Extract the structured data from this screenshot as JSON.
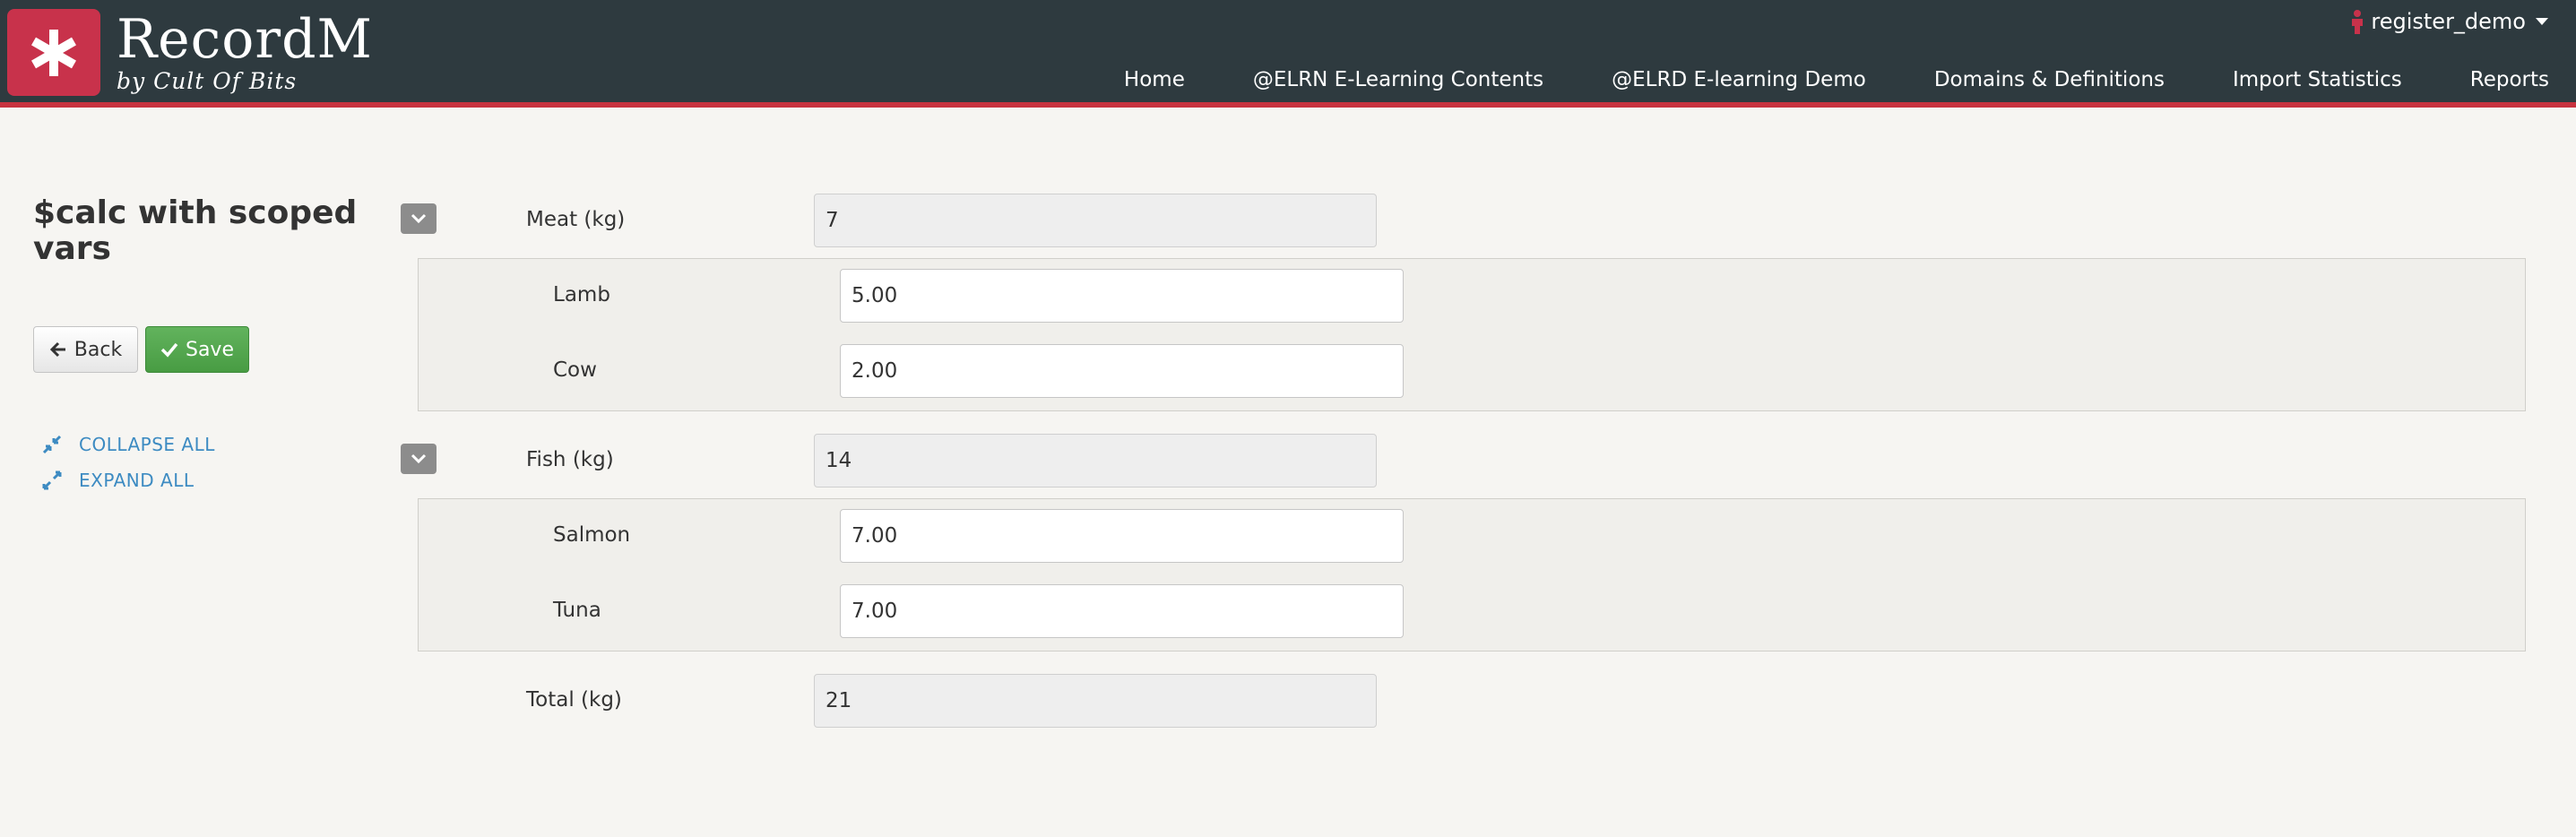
{
  "app": {
    "brand": "RecordM",
    "tagline": "by Cult Of Bits",
    "user": "register_demo"
  },
  "nav": [
    "Home",
    "@ELRN E-Learning Contents",
    "@ELRD E-learning Demo",
    "Domains & Definitions",
    "Import Statistics",
    "Reports"
  ],
  "page": {
    "title": "$calc with scoped vars",
    "back_label": "Back",
    "save_label": "Save",
    "collapse_all": "COLLAPSE ALL",
    "expand_all": "EXPAND ALL"
  },
  "form": {
    "meat": {
      "label": "Meat (kg)",
      "value": "7",
      "lamb": {
        "label": "Lamb",
        "value": "5.00"
      },
      "cow": {
        "label": "Cow",
        "value": "2.00"
      }
    },
    "fish": {
      "label": "Fish (kg)",
      "value": "14",
      "salmon": {
        "label": "Salmon",
        "value": "7.00"
      },
      "tuna": {
        "label": "Tuna",
        "value": "7.00"
      }
    },
    "total": {
      "label": "Total (kg)",
      "value": "21"
    }
  },
  "colors": {
    "header_bg": "#2e3a3f",
    "accent": "#c8323f",
    "logo_bg": "#c8324b",
    "save_green": "#489c43",
    "link_blue": "#3d8bc2"
  }
}
